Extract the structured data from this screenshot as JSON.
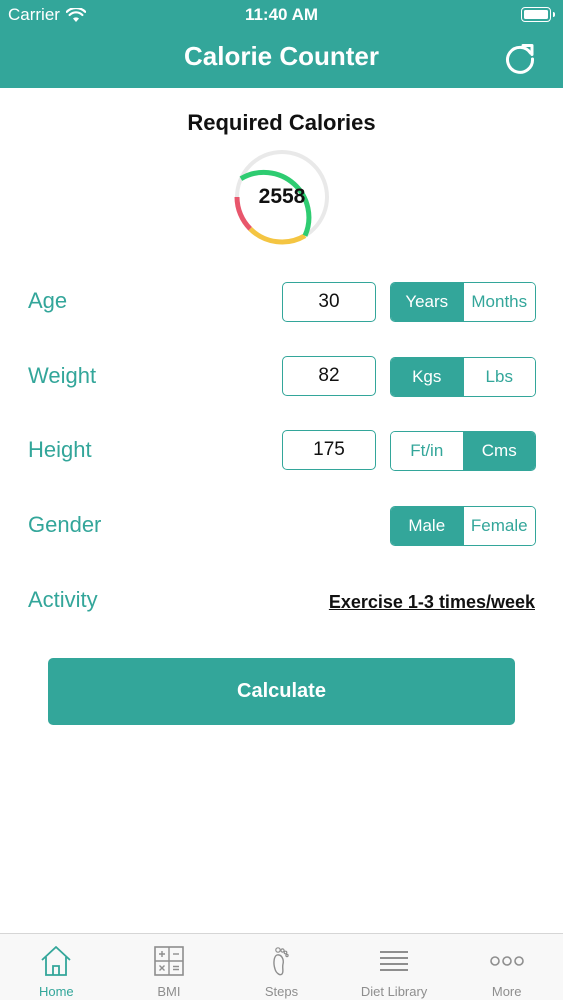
{
  "status": {
    "carrier": "Carrier",
    "time": "11:40 AM"
  },
  "header": {
    "title": "Calorie Counter",
    "refresh_icon": "refresh-icon"
  },
  "summary": {
    "title": "Required Calories",
    "value": "2558"
  },
  "form": {
    "age": {
      "label": "Age",
      "value": "30",
      "options": [
        "Years",
        "Months"
      ],
      "selected": "Years"
    },
    "weight": {
      "label": "Weight",
      "value": "82",
      "options": [
        "Kgs",
        "Lbs"
      ],
      "selected": "Kgs"
    },
    "height": {
      "label": "Height",
      "value": "175",
      "options": [
        "Ft/in",
        "Cms"
      ],
      "selected": "Cms"
    },
    "gender": {
      "label": "Gender",
      "options": [
        "Male",
        "Female"
      ],
      "selected": "Male"
    },
    "activity": {
      "label": "Activity",
      "value": "Exercise 1-3 times/week"
    }
  },
  "calculate_label": "Calculate",
  "tabs": [
    {
      "label": "Home",
      "icon": "home-icon",
      "active": true
    },
    {
      "label": "BMI",
      "icon": "calculator-icon",
      "active": false
    },
    {
      "label": "Steps",
      "icon": "footprint-icon",
      "active": false
    },
    {
      "label": "Diet Library",
      "icon": "list-icon",
      "active": false
    },
    {
      "label": "More",
      "icon": "more-icon",
      "active": false
    }
  ],
  "colors": {
    "accent": "#33a69a",
    "ring_green": "#2ecc71",
    "ring_yellow": "#f4c542",
    "ring_red": "#e8566c"
  }
}
